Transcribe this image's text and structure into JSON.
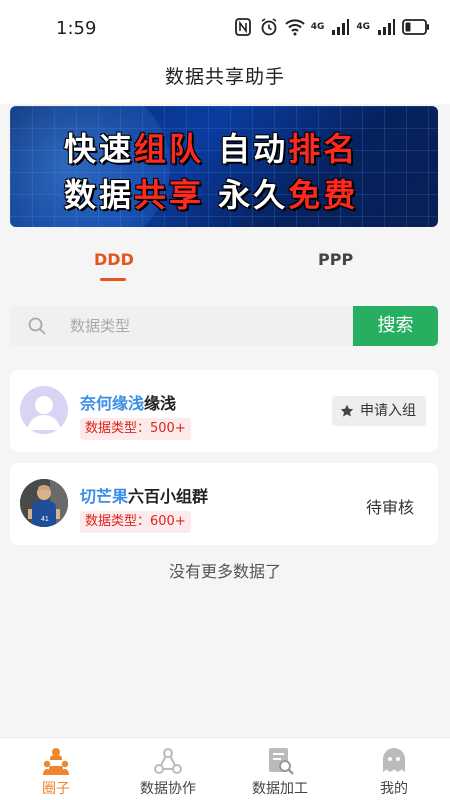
{
  "status_bar": {
    "time": "1:59",
    "network_1": "4G",
    "network_2": "4G"
  },
  "header": {
    "title": "数据共享助手"
  },
  "banner": {
    "line1": [
      {
        "text": "快速",
        "style": "w"
      },
      {
        "text": "组队",
        "style": "r"
      },
      {
        "text": " 自动",
        "style": "w"
      },
      {
        "text": "排名",
        "style": "r"
      }
    ],
    "line2": [
      {
        "text": "数据",
        "style": "w"
      },
      {
        "text": "共享",
        "style": "r"
      },
      {
        "text": " 永久",
        "style": "w"
      },
      {
        "text": "免费",
        "style": "r"
      }
    ]
  },
  "tabs": [
    {
      "label": "DDD",
      "active": true
    },
    {
      "label": "PPP",
      "active": false
    }
  ],
  "search": {
    "placeholder": "数据类型",
    "value": "",
    "button_label": "搜索"
  },
  "groups": [
    {
      "name_highlight": "奈何缘浅",
      "name_rest": "缘浅",
      "tag": "数据类型：500+",
      "action": "申请入组",
      "action_type": "button"
    },
    {
      "name_highlight": "切芒果",
      "name_rest": "六百小组群",
      "tag": "数据类型：600+",
      "action": "待审核",
      "action_type": "status"
    }
  ],
  "list_footer": "没有更多数据了",
  "tabbar": [
    {
      "label": "圈子",
      "icon": "people-circle-icon",
      "active": true
    },
    {
      "label": "数据协作",
      "icon": "share-nodes-icon",
      "active": false
    },
    {
      "label": "数据加工",
      "icon": "document-search-icon",
      "active": false
    },
    {
      "label": "我的",
      "icon": "profile-icon",
      "active": false
    }
  ],
  "colors": {
    "accent": "#e8531c",
    "search_button": "#27ae60",
    "link_blue": "#3b8ee8",
    "tag_red": "#d9261c",
    "tabbar_active": "#f0852d"
  }
}
